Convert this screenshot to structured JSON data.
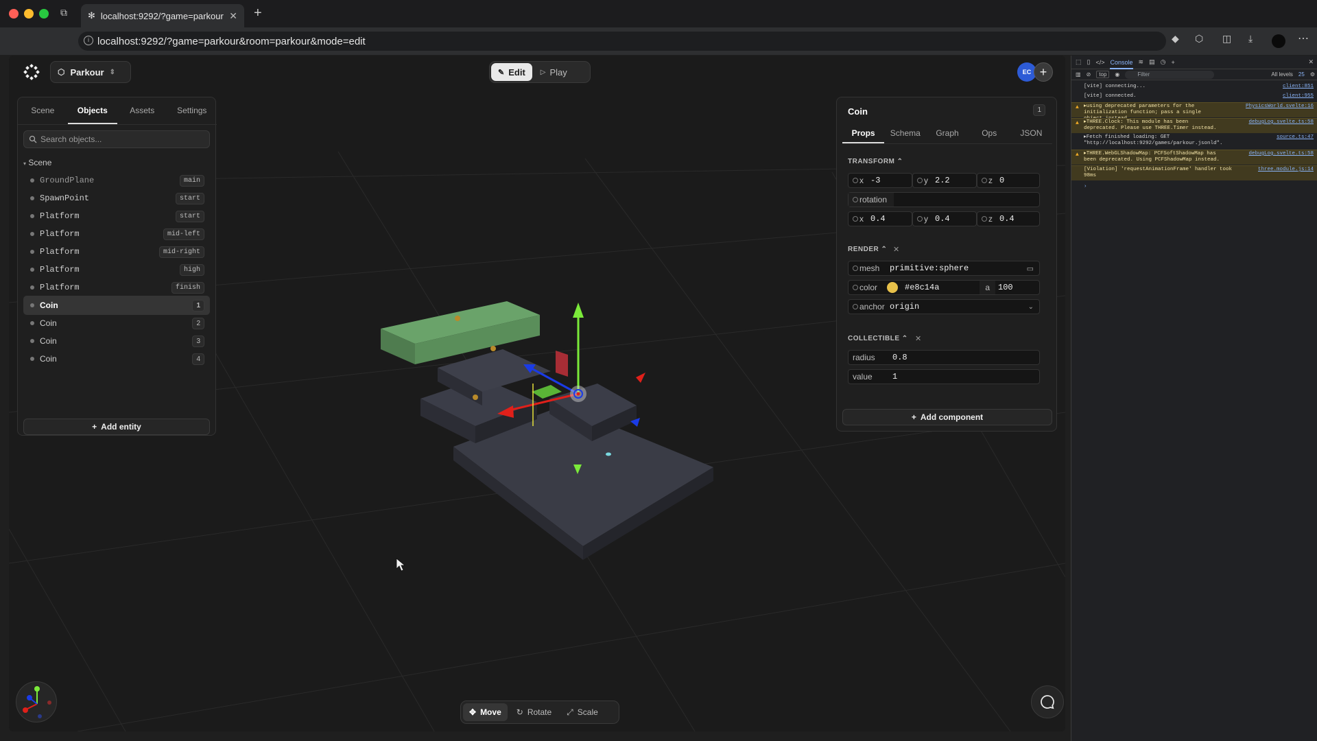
{
  "browser": {
    "tab_title": "localhost:9292/?game=parkour&",
    "url": "localhost:9292/?game=parkour&room=parkour&mode=edit"
  },
  "app": {
    "project_name": "Parkour",
    "modes": {
      "edit": "Edit",
      "play": "Play"
    },
    "avatar_initials": "EC"
  },
  "left_panel": {
    "tabs": [
      "Scene",
      "Objects",
      "Assets",
      "Settings"
    ],
    "active_tab": "Objects",
    "search_placeholder": "Search objects...",
    "scene_label": "Scene",
    "objects": [
      {
        "name": "GroundPlane",
        "badge": "main"
      },
      {
        "name": "SpawnPoint",
        "badge": "start"
      },
      {
        "name": "Platform",
        "badge": "start"
      },
      {
        "name": "Platform",
        "badge": "mid-left"
      },
      {
        "name": "Platform",
        "badge": "mid-right"
      },
      {
        "name": "Platform",
        "badge": "high"
      },
      {
        "name": "Platform",
        "badge": "finish"
      },
      {
        "name": "Coin",
        "badge": "1"
      },
      {
        "name": "Coin",
        "badge": "2"
      },
      {
        "name": "Coin",
        "badge": "3"
      },
      {
        "name": "Coin",
        "badge": "4"
      }
    ],
    "add_entity_label": "Add entity"
  },
  "inspector": {
    "title": "Coin",
    "count": "1",
    "tabs": [
      "Props",
      "Schema",
      "Graph",
      "Ops",
      "JSON"
    ],
    "active_tab": "Props",
    "transform": {
      "header": "TRANSFORM",
      "position": {
        "x_label": "x",
        "x": "-3",
        "y_label": "y",
        "y": "2.2",
        "z_label": "z",
        "z": "0"
      },
      "rotation_label": "rotation",
      "scale": {
        "x_label": "x",
        "x": "0.4",
        "y_label": "y",
        "y": "0.4",
        "z_label": "z",
        "z": "0.4"
      }
    },
    "render": {
      "header": "RENDER",
      "mesh_label": "mesh",
      "mesh": "primitive:sphere",
      "color_label": "color",
      "color": "#e8c14a",
      "alpha_label": "a",
      "alpha": "100",
      "anchor_label": "anchor",
      "anchor": "origin"
    },
    "collectible": {
      "header": "COLLECTIBLE",
      "radius_label": "radius",
      "radius": "0.8",
      "value_label": "value",
      "value": "1"
    },
    "add_component_label": "Add component"
  },
  "tools": {
    "move": "Move",
    "rotate": "Rotate",
    "scale": "Scale",
    "active": "Move"
  },
  "devtools": {
    "active_panel": "Console",
    "context": "top",
    "filter_placeholder": "Filter",
    "levels": "All levels",
    "issue_count": "25",
    "logs": [
      {
        "type": "info",
        "text": "[vite] connecting...",
        "src": "client:851"
      },
      {
        "type": "info",
        "text": "[vite] connected.",
        "src": "client:955"
      },
      {
        "type": "warn",
        "text": "▸using deprecated parameters for the initialization function; pass a single object instead",
        "src": "PhysicsWorld.svelte:16"
      },
      {
        "type": "warn",
        "text": "▸THREE.Clock: This module has been deprecated. Please use THREE.Timer instead.",
        "src": "debugLog.svelte.ts:58"
      },
      {
        "type": "info",
        "text": "▸Fetch finished loading: GET \"http://localhost:9292/games/parkour.jsonld\".",
        "src": "source.ts:47"
      },
      {
        "type": "warn",
        "text": "▸THREE.WebGLShadowMap: PCFSoftShadowMap has been deprecated. Using PCFShadowMap instead.",
        "src": "debugLog.svelte.ts:58"
      },
      {
        "type": "warn",
        "text": "[Violation] 'requestAnimationFrame' handler took 98ms",
        "src": "three.module.js:14"
      }
    ]
  },
  "colors": {
    "coin": "#e8c14a",
    "platform_green": "#6aa36a",
    "gizmo_x": "#e0201a",
    "gizmo_y": "#7bea3a",
    "gizmo_z": "#1a3be6"
  }
}
